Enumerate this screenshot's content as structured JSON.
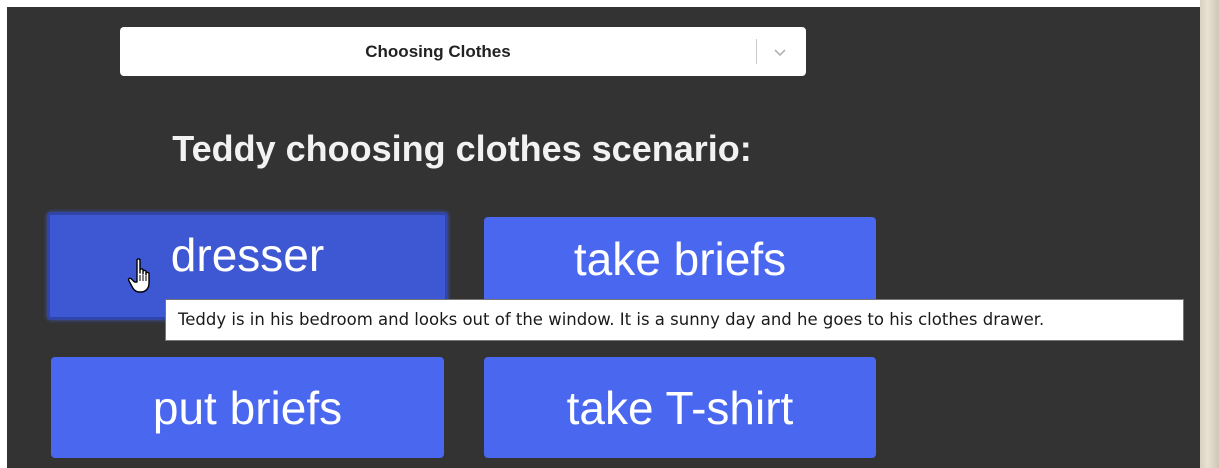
{
  "scenario_select": {
    "selected": "Choosing Clothes",
    "icon": "chevron-down-icon"
  },
  "heading": "Teddy choosing clothes scenario:",
  "buttons": [
    {
      "label": "dresser",
      "state": "hover"
    },
    {
      "label": "take briefs"
    },
    {
      "label": "put briefs"
    },
    {
      "label": "take T-shirt"
    }
  ],
  "tooltip": "Teddy is in his bedroom and looks out of the window. It is a sunny day and he goes to his clothes drawer.",
  "cursor": "hand-pointer-icon",
  "colors": {
    "background": "#333333",
    "button": "#4a67f0",
    "button_hover": "#3d58d2",
    "heading_text": "#f2f2f2"
  }
}
